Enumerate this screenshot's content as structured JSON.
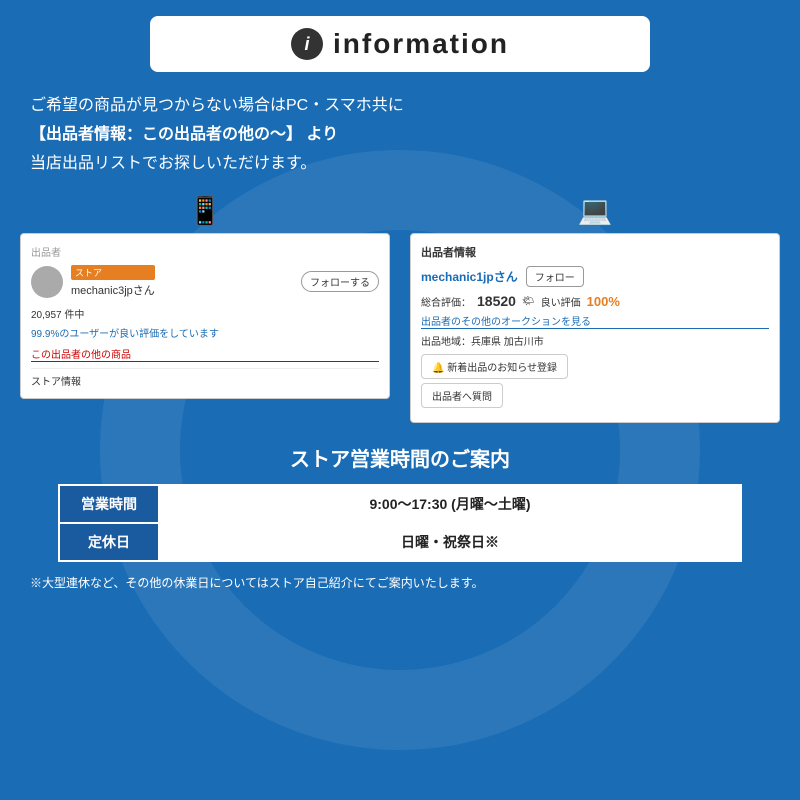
{
  "header": {
    "icon_label": "i",
    "title": "information"
  },
  "description": {
    "line1": "ご希望の商品が見つからない場合はPC・スマホ共に",
    "line2": "【出品者情報：この出品者の他の〜】 より",
    "line3": "当店出品リストでお探しいただけます。"
  },
  "mobile_screen": {
    "device_icon": "📱",
    "section_label": "出品者",
    "store_badge": "ストア",
    "username": "mechanic3jpさん",
    "follow_btn": "フォローする",
    "stats": "20,957 件中",
    "good_rate": "99.9%のユーザーが良い評価をしています",
    "link_text": "この出品者の他の商品",
    "store_info": "ストア情報"
  },
  "pc_screen": {
    "device_icon": "💻",
    "section_label": "出品者情報",
    "username": "mechanic1jpさん",
    "follow_btn": "フォロー",
    "rating_label": "総合評価：",
    "rating_num": "18520",
    "good_label": "良い評価",
    "good_pct": "100%",
    "auction_link": "出品者のその他のオークションを見る",
    "location": "出品地域：兵庫県 加古川市",
    "notify_btn": "🔔 新着出品のお知らせ登録",
    "question_btn": "出品者へ質問"
  },
  "store_hours": {
    "title": "ストア営業時間のご案内",
    "rows": [
      {
        "label": "営業時間",
        "value": "9:00〜17:30 (月曜〜土曜)"
      },
      {
        "label": "定休日",
        "value": "日曜・祝祭日※"
      }
    ],
    "footnote": "※大型連休など、その他の休業日についてはストア自己紹介にてご案内いたします。"
  }
}
